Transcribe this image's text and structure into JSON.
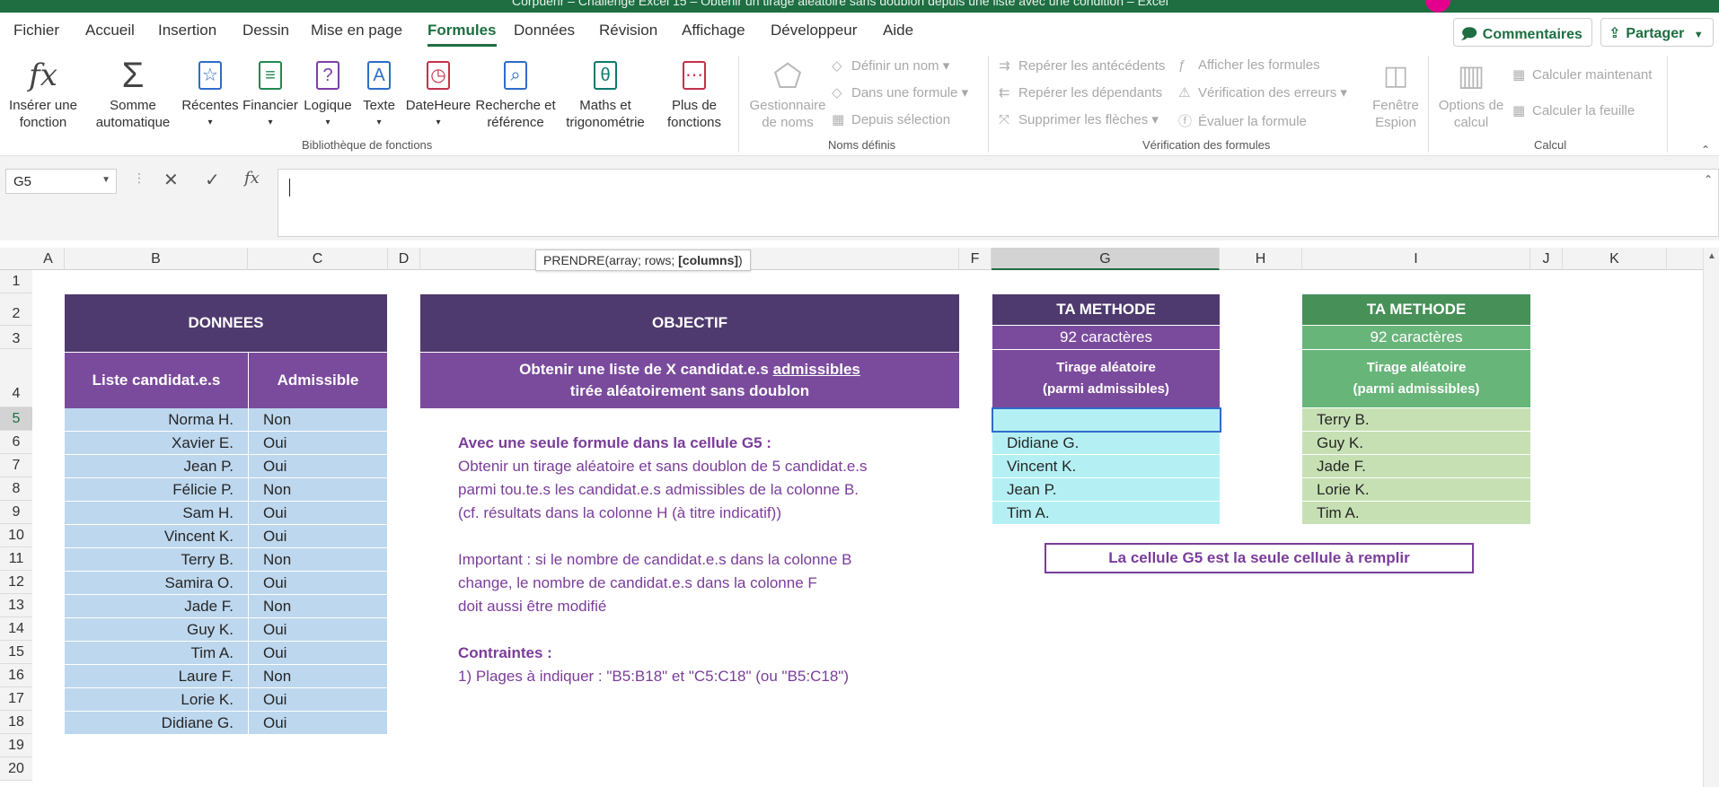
{
  "titlebar": {
    "title": "Corpuenr – Challenge Excel 15 – Obtenir un tirage aléatoire sans doublon depuis une liste avec une condition – Excel"
  },
  "menu": {
    "tabs": [
      "Fichier",
      "Accueil",
      "Insertion",
      "Dessin",
      "Mise en page",
      "Formules",
      "Données",
      "Révision",
      "Affichage",
      "Développeur",
      "Aide"
    ],
    "active": "Formules",
    "comments_label": "Commentaires",
    "share_label": "Partager"
  },
  "ribbon": {
    "insert_function": "Insérer une fonction",
    "autosum": "Somme automatique",
    "recent": "Récentes",
    "financial": "Financier",
    "logical": "Logique",
    "text": "Texte",
    "datetime": "DateHeure",
    "lookup": "Recherche et référence",
    "math": "Maths et trigonométrie",
    "more": "Plus de fonctions",
    "group_library": "Bibliothèque de fonctions",
    "name_manager": "Gestionnaire de noms",
    "define_name": "Définir un nom",
    "use_in_formula": "Dans une formule",
    "from_selection": "Depuis sélection",
    "group_names": "Noms définis",
    "trace_precedents": "Repérer les antécédents",
    "trace_dependents": "Repérer les dépendants",
    "remove_arrows": "Supprimer les flèches",
    "show_formulas": "Afficher les formules",
    "error_checking": "Vérification des erreurs",
    "evaluate_formula": "Évaluer la formule",
    "watch_window": "Fenêtre Espion",
    "group_audit": "Vérification des formules",
    "calc_options": "Options de calcul",
    "calc_now": "Calculer maintenant",
    "calc_sheet": "Calculer la feuille",
    "group_calc": "Calcul"
  },
  "formula_bar": {
    "name_box": "G5",
    "value": ""
  },
  "tooltip": {
    "prefix": "PRENDRE(array; rows; ",
    "bold": "[columns]",
    "suffix": ")"
  },
  "columns": [
    "A",
    "B",
    "C",
    "D",
    "E",
    "F",
    "G",
    "H",
    "I",
    "J",
    "K"
  ],
  "rows": [
    "1",
    "2",
    "3",
    "4",
    "5",
    "6",
    "7",
    "8",
    "9",
    "10",
    "11",
    "12",
    "13",
    "14",
    "15",
    "16",
    "17",
    "18",
    "19",
    "20"
  ],
  "sheet": {
    "donnees_title": "DONNEES",
    "col_b_header": "Liste candidat.e.s",
    "col_c_header": "Admissible",
    "candidates": [
      {
        "name": "Norma H.",
        "adm": "Non"
      },
      {
        "name": "Xavier E.",
        "adm": "Oui"
      },
      {
        "name": "Jean P.",
        "adm": "Oui"
      },
      {
        "name": "Félicie P.",
        "adm": "Non"
      },
      {
        "name": "Sam H.",
        "adm": "Oui"
      },
      {
        "name": "Vincent K.",
        "adm": "Oui"
      },
      {
        "name": "Terry B.",
        "adm": "Non"
      },
      {
        "name": "Samira O.",
        "adm": "Oui"
      },
      {
        "name": "Jade F.",
        "adm": "Non"
      },
      {
        "name": "Guy K.",
        "adm": "Oui"
      },
      {
        "name": "Tim A.",
        "adm": "Oui"
      },
      {
        "name": "Laure F.",
        "adm": "Non"
      },
      {
        "name": "Lorie K.",
        "adm": "Oui"
      },
      {
        "name": "Didiane G.",
        "adm": "Oui"
      }
    ],
    "objectif_title": "OBJECTIF",
    "objectif_line1a": "Obtenir une liste de X candidat.e.s ",
    "objectif_line1b": "admissibles ",
    "objectif_line2": "tirée aléatoirement sans doublon",
    "instructions": {
      "heading": "Avec une seule formule dans la cellule G5 :",
      "l1": "Obtenir un tirage aléatoire et sans doublon de 5 candidat.e.s",
      "l2": "parmi tou.te.s les candidat.e.s admissibles de la colonne B.",
      "l3": "(cf. résultats dans la colonne H (à titre indicatif))",
      "l4": "Important : si le nombre de candidat.e.s dans la colonne B",
      "l5": "change, le nombre de candidat.e.s dans la colonne F",
      "l6": "doit aussi être modifié",
      "constraints": "Contraintes :",
      "c1": "1) Plages à indiquer : \"B5:B18\" et \"C5:C18\" (ou \"B5:C18\")"
    },
    "g": {
      "title": "TA METHODE",
      "chars": "92 caractères",
      "sub1": "Tirage aléatoire",
      "sub2": "(parmi admissibles)",
      "values": [
        "",
        "Didiane G.",
        "Vincent K.",
        "Jean P.",
        "Tim A."
      ]
    },
    "i": {
      "title": "TA METHODE",
      "chars": "92 caractères",
      "sub1": "Tirage aléatoire",
      "sub2": "(parmi admissibles)",
      "values": [
        "Terry B.",
        "Guy K.",
        "Jade F.",
        "Lorie K.",
        "Tim A."
      ]
    },
    "note": "La cellule G5 est la seule cellule à remplir"
  }
}
